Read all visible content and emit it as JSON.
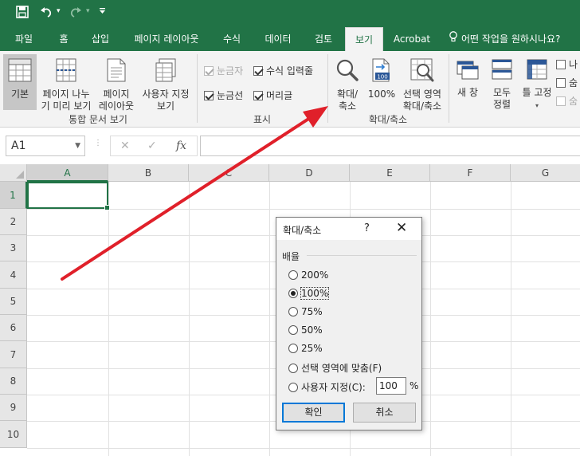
{
  "tabs": [
    {
      "label": "파일",
      "active": false
    },
    {
      "label": "홈",
      "active": false
    },
    {
      "label": "삽입",
      "active": false
    },
    {
      "label": "페이지 레이아웃",
      "active": false
    },
    {
      "label": "수식",
      "active": false
    },
    {
      "label": "데이터",
      "active": false
    },
    {
      "label": "검토",
      "active": false
    },
    {
      "label": "보기",
      "active": true
    },
    {
      "label": "Acrobat",
      "active": false
    }
  ],
  "tellme": "어떤 작업을 원하시나요?",
  "ribbon": {
    "workbook_views": {
      "normal": "기본",
      "page_break_line1": "페이지 나누",
      "page_break_line2": "기 미리 보기",
      "page_layout_line1": "페이지",
      "page_layout_line2": "레이아웃",
      "custom_views_line1": "사용자 지정",
      "custom_views_line2": "보기",
      "group_label": "통합 문서 보기"
    },
    "show": {
      "ruler": "눈금자",
      "formula_bar": "수식 입력줄",
      "gridlines": "눈금선",
      "headings": "머리글",
      "group_label": "표시"
    },
    "zoom": {
      "zoom_line1": "확대/",
      "zoom_line2": "축소",
      "zoom_100": "100%",
      "zoom_icon_text": "100",
      "zoom_selection_line1": "선택 영역",
      "zoom_selection_line2": "확대/축소",
      "group_label": "확대/축소"
    },
    "window": {
      "new_window_line1": "새 창",
      "arrange_all_line1": "모두",
      "arrange_all_line2": "정렬",
      "freeze_panes": "틀 고정",
      "partial_1": "나",
      "partial_2": "숨",
      "partial_3": "숨"
    }
  },
  "formula_bar": {
    "name_box": "A1",
    "fx": "fx"
  },
  "grid": {
    "columns": [
      "A",
      "B",
      "C",
      "D",
      "E",
      "F",
      "G"
    ],
    "rows": [
      "1",
      "2",
      "3",
      "4",
      "5",
      "6",
      "7",
      "8",
      "9",
      "10"
    ],
    "selected_cell": "A1"
  },
  "dialog": {
    "title": "확대/축소",
    "help": "?",
    "section": "배율",
    "options": [
      {
        "label": "200%",
        "selected": false
      },
      {
        "label": "100%",
        "selected": true
      },
      {
        "label": "75%",
        "selected": false
      },
      {
        "label": "50%",
        "selected": false
      },
      {
        "label": "25%",
        "selected": false
      },
      {
        "label": "선택 영역에 맞춤(F)",
        "selected": false
      },
      {
        "label": "사용자 지정(C):",
        "selected": false
      }
    ],
    "custom_value": "100",
    "percent_sign": "%",
    "ok": "확인",
    "cancel": "취소"
  },
  "colors": {
    "excel_green": "#217346",
    "arrow": "#e0202a",
    "focus_blue": "#0078d7"
  }
}
